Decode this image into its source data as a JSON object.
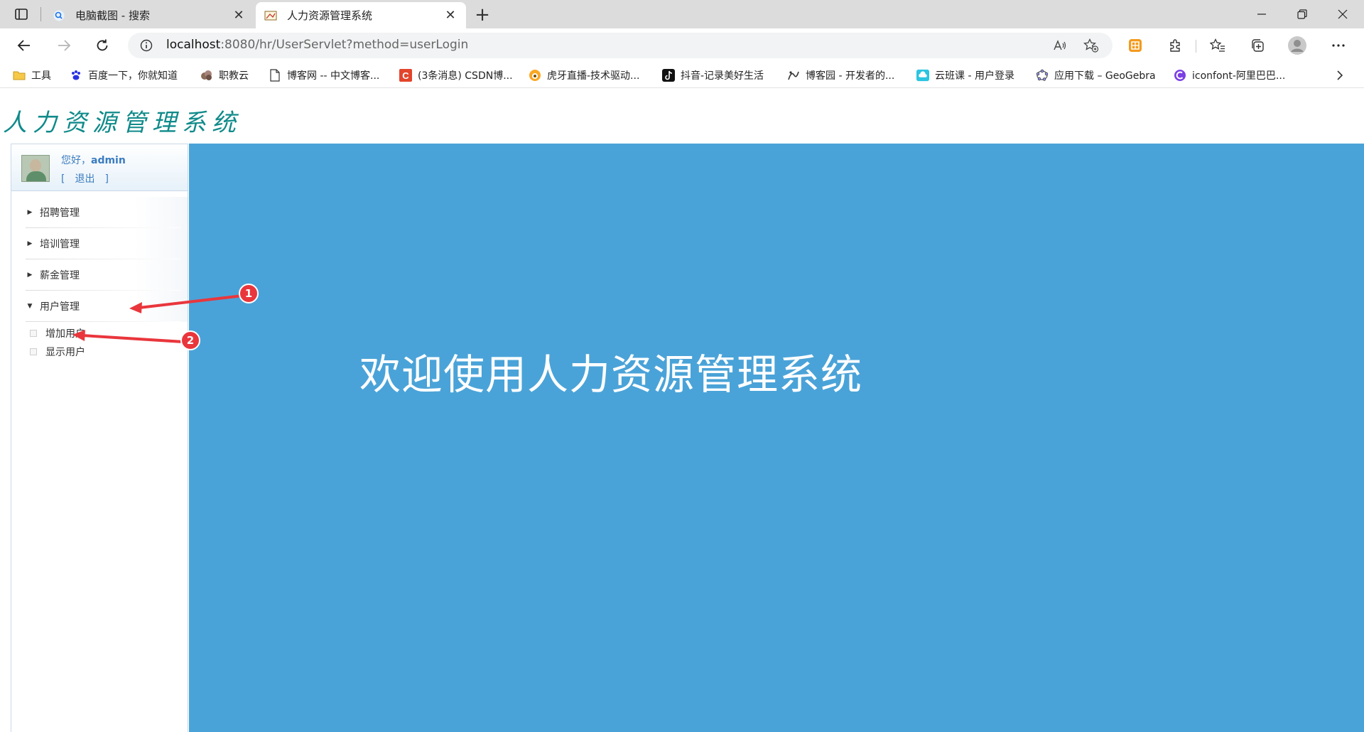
{
  "browser": {
    "tabs": [
      {
        "label": "电脑截图 - 搜索",
        "icon": "search-icon",
        "active": false
      },
      {
        "label": "人力资源管理系统",
        "icon": "page-icon",
        "active": true
      }
    ],
    "new_tab": "+",
    "address": {
      "host": "localhost",
      "rest": ":8080/hr/UserServlet?method=userLogin"
    },
    "bookmarks": [
      {
        "label": "工具",
        "icon": "folder-icon"
      },
      {
        "label": "百度一下，你就知道",
        "icon": "baidu-icon"
      },
      {
        "label": "职教云",
        "icon": "zhijiaoyun-icon"
      },
      {
        "label": "博客网 -- 中文博客...",
        "icon": "document-icon"
      },
      {
        "label": "(3条消息) CSDN博...",
        "icon": "csdn-icon"
      },
      {
        "label": "虎牙直播-技术驱动...",
        "icon": "huya-icon"
      },
      {
        "label": "抖音-记录美好生活",
        "icon": "douyin-icon"
      },
      {
        "label": "博客园 - 开发者的...",
        "icon": "cnblogs-icon"
      },
      {
        "label": "云班课 - 用户登录",
        "icon": "yunbanke-icon"
      },
      {
        "label": "应用下载 – GeoGebra",
        "icon": "geogebra-icon"
      },
      {
        "label": "iconfont-阿里巴巴...",
        "icon": "iconfont-icon"
      }
    ]
  },
  "app": {
    "logo": "人力资源管理系统",
    "user": {
      "greeting": "您好，",
      "name": "admin",
      "logout_open": "[",
      "logout": "退出",
      "logout_close": "]"
    },
    "menu": [
      {
        "label": "招聘管理",
        "expanded": false
      },
      {
        "label": "培训管理",
        "expanded": false
      },
      {
        "label": "薪金管理",
        "expanded": false
      },
      {
        "label": "用户管理",
        "expanded": true
      }
    ],
    "submenu": [
      {
        "label": "增加用户"
      },
      {
        "label": "显示用户"
      }
    ],
    "welcome": "欢迎使用人力资源管理系统"
  },
  "annotations": [
    {
      "number": "1",
      "color": "#e9363c"
    },
    {
      "number": "2",
      "color": "#e9363c"
    }
  ],
  "colors": {
    "main_bg": "#4aa3d8",
    "logo": "#108a8a",
    "link": "#3a7cc0"
  }
}
